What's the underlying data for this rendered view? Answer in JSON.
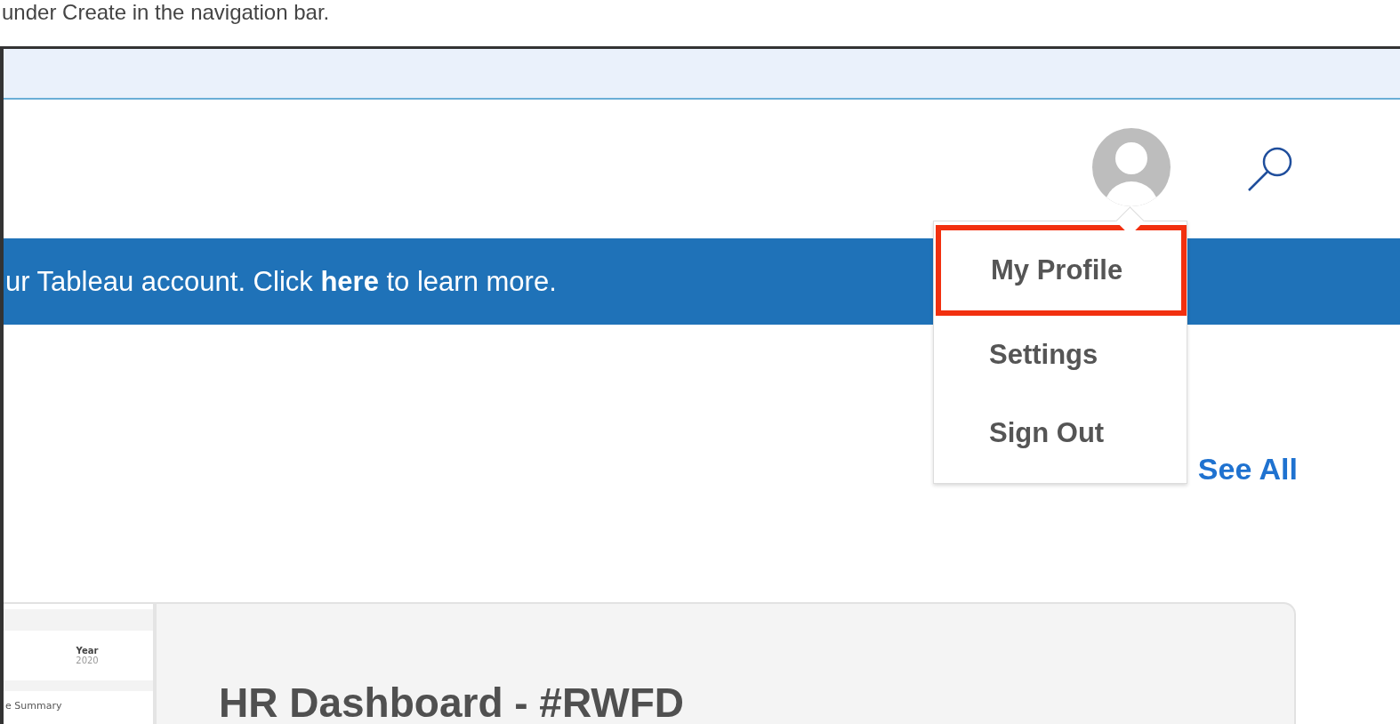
{
  "caption": "under Create in the navigation bar.",
  "banner": {
    "text": "ur Tableau account. Click **here** to learn more."
  },
  "account_menu": [
    {
      "label": "My Profile",
      "highlighted": true
    },
    {
      "label": "Settings",
      "highlighted": false
    },
    {
      "label": "Sign Out",
      "highlighted": false
    }
  ],
  "see_all": "See All",
  "card": {
    "thumbnail": {
      "filter_label": "Year",
      "filter_value": "2020",
      "section": "e Summary"
    },
    "title": "HR Dashboard - #RWFD"
  }
}
